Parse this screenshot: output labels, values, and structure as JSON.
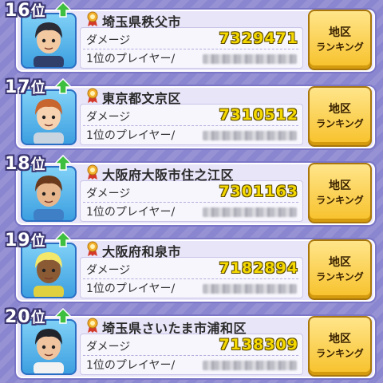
{
  "rank_suffix": "位",
  "dmg_label": "ダメージ",
  "player_label": "1位のプレイヤー/",
  "button": {
    "line1": "地区",
    "line2": "ランキング"
  },
  "rows": [
    {
      "rank": "16",
      "region": "埼玉県秩父市",
      "damage": "7329471",
      "avatar": "dark-haired-boy-face"
    },
    {
      "rank": "17",
      "region": "東京都文京区",
      "damage": "7310512",
      "avatar": "brown-haired-girl-face"
    },
    {
      "rank": "18",
      "region": "大阪府大阪市住之江区",
      "damage": "7301163",
      "avatar": "brown-haired-boy-face"
    },
    {
      "rank": "19",
      "region": "大阪府和泉市",
      "damage": "7182894",
      "avatar": "capped-boy-face"
    },
    {
      "rank": "20",
      "region": "埼玉県さいたま市浦和区",
      "damage": "7138309",
      "avatar": "dark-haired-boy-face"
    }
  ],
  "colors": {
    "damage": "#f4d800",
    "button": "#f7c12a",
    "background": "#8a86cf"
  }
}
